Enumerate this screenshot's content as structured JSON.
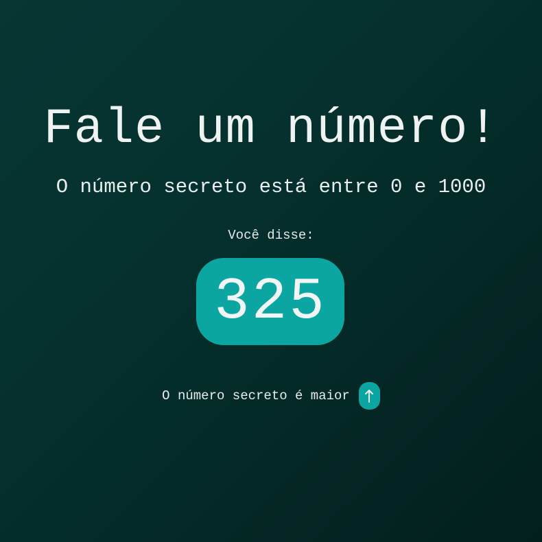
{
  "title": "Fale um número!",
  "subtitle": "O número secreto está entre 0 e 1000",
  "guess": {
    "label": "Você disse:",
    "value": "325"
  },
  "hint": {
    "text": "O número secreto é maior",
    "direction_icon": "arrow-up-icon"
  },
  "colors": {
    "background_start": "#073633",
    "background_end": "#021f1d",
    "accent": "#0ba6a2",
    "text": "#eef2f1"
  }
}
